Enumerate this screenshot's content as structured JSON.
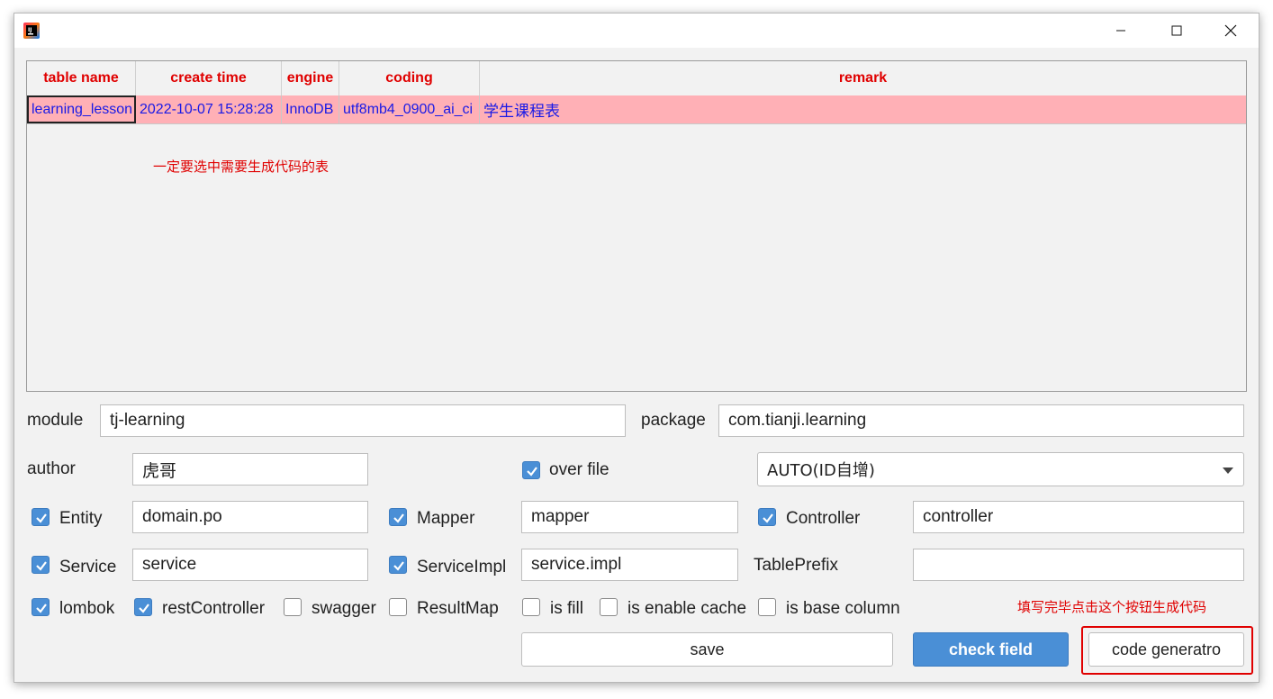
{
  "window": {
    "app_icon": "intellij-idea-icon",
    "minimize": "minimize-icon",
    "maximize": "maximize-icon",
    "close": "close-icon"
  },
  "table": {
    "headers": [
      "table name",
      "create time",
      "engine",
      "coding",
      "remark"
    ],
    "rows": [
      [
        "learning_lesson",
        "2022-10-07 15:28:28",
        "InnoDB",
        "utf8mb4_0900_ai_ci",
        "学生课程表"
      ]
    ],
    "header_color": "#e00000",
    "row_highlight": "#ffb0b6",
    "cell_text_color": "#1a1ae6"
  },
  "annotations": {
    "select_table_note": "一定要选中需要生成代码的表",
    "generate_note": "填写完毕点击这个按钮生成代码"
  },
  "form": {
    "module_label": "module",
    "module_value": "tj-learning",
    "package_label": "package",
    "package_value": "com.tianji.learning",
    "author_label": "author",
    "author_value": "虎哥",
    "over_file_label": "over file",
    "over_file_checked": true,
    "id_type_value": "AUTO(ID自增)",
    "entity_label": "Entity",
    "entity_value": "domain.po",
    "mapper_label": "Mapper",
    "mapper_value": "mapper",
    "controller_label": "Controller",
    "controller_value": "controller",
    "service_label": "Service",
    "service_value": "service",
    "serviceimpl_label": "ServiceImpl",
    "serviceimpl_value": "service.impl",
    "tableprefix_label": "TablePrefix",
    "tableprefix_value": "",
    "options": {
      "lombok": "lombok",
      "restController": "restController",
      "swagger": "swagger",
      "resultMap": "ResultMap",
      "isFill": "is fill",
      "isEnableCache": "is enable cache",
      "isBaseColumn": "is base column"
    }
  },
  "buttons": {
    "save": "save",
    "check_field": "check field",
    "code_generate": "code generatro"
  },
  "colors": {
    "accent": "#4a8fd6",
    "annotation_red": "#e00000"
  }
}
